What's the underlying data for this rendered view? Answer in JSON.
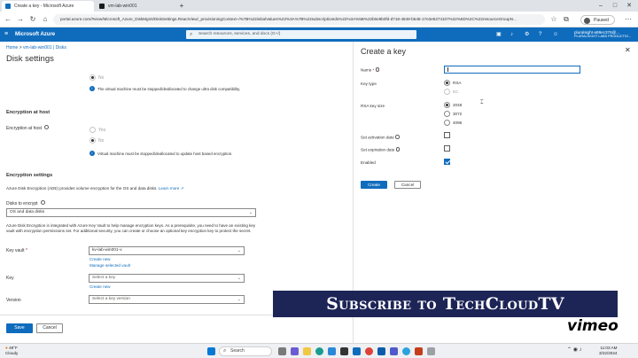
{
  "browser": {
    "tabs": [
      {
        "label": "Create a key - Microsoft Azure",
        "favicon_color": "#0f6cbd"
      },
      {
        "label": "vm-lab-win001",
        "favicon_color": "#1b1b1b"
      }
    ],
    "new_tab": "+",
    "url": "portal.azure.com/#view/Microsoft_Azure_DiskMgmt/DiskSettings.ReactView/_provisioningContext~/%7B%22initialValues%22%3A%7B%22subscriptionIds%22%3A%5B%22b0e9b0fd-d718-4849-b548-17e3e5274107%22%5D%2C%22resourceGroupN...",
    "paused_label": "Paused"
  },
  "portal": {
    "brand": "Microsoft Azure",
    "search_placeholder": "Search resources, services, and docs (G+/)",
    "account_line1": "pluralsight-a99ec376@...",
    "account_line2": "PLURALSIGHT LABS PRODUCTIO..."
  },
  "breadcrumb": {
    "home": "Home",
    "sep": ">",
    "resource": "vm-lab-win001 | Disks"
  },
  "page_title": "Disk settings",
  "disk_settings": {
    "top_no": "No",
    "top_info": "The virtual machine must be stopped/deallocated to change ultra disk compatibility.",
    "enc_host_heading": "Encryption at host",
    "enc_host_label": "Encryption at host",
    "enc_host_yes": "Yes",
    "enc_host_no": "No",
    "enc_host_info": "Virtual machine must be stopped/deallocated to update host based encryption.",
    "enc_settings_heading": "Encryption settings",
    "ade_desc": "Azure Disk Encryption (ADE) provides volume encryption for the OS and data disks.",
    "learn_more": "Learn more",
    "disks_label": "Disks to encrypt",
    "disks_value": "OS and data disks",
    "kv_desc": "Azure Disk Encryption is integrated with Azure Key Vault to help manage encryption keys. As a prerequisite, you need to have an existing key vault with encryption permissions set. For additional security, you can create or choose an optional key encryption key to protect the secret.",
    "key_vault_label": "Key vault",
    "key_vault_value": "kv-lab-win001-x",
    "create_new": "Create new",
    "manage_vault": "Manage selected vault",
    "key_label": "Key",
    "key_placeholder": "Select a key",
    "key_create_new": "Create new",
    "version_label": "Version",
    "version_placeholder": "Select a key version",
    "save": "Save",
    "cancel": "Cancel"
  },
  "create_key": {
    "title": "Create a key",
    "name_label": "Name",
    "key_type_label": "Key type",
    "key_type_rsa": "RSA",
    "key_type_ec": "EC",
    "rsa_size_label": "RSA key size",
    "sizes": [
      "2048",
      "3072",
      "4096"
    ],
    "activation_label": "Set activation date",
    "expiration_label": "Set expiration date",
    "enabled_label": "Enabled",
    "create": "Create",
    "cancel": "Cancel"
  },
  "overlay": {
    "banner": "Subscribe to TechCloudTV",
    "vimeo": "vimeo"
  },
  "taskbar": {
    "weather_temp": "49°F",
    "weather_desc": "Cloudy",
    "search": "Search",
    "time": "11:03 AM",
    "date": "3/22/2024"
  },
  "colors": {
    "accent": "#0f6cbd",
    "banner": "#1d2557"
  }
}
